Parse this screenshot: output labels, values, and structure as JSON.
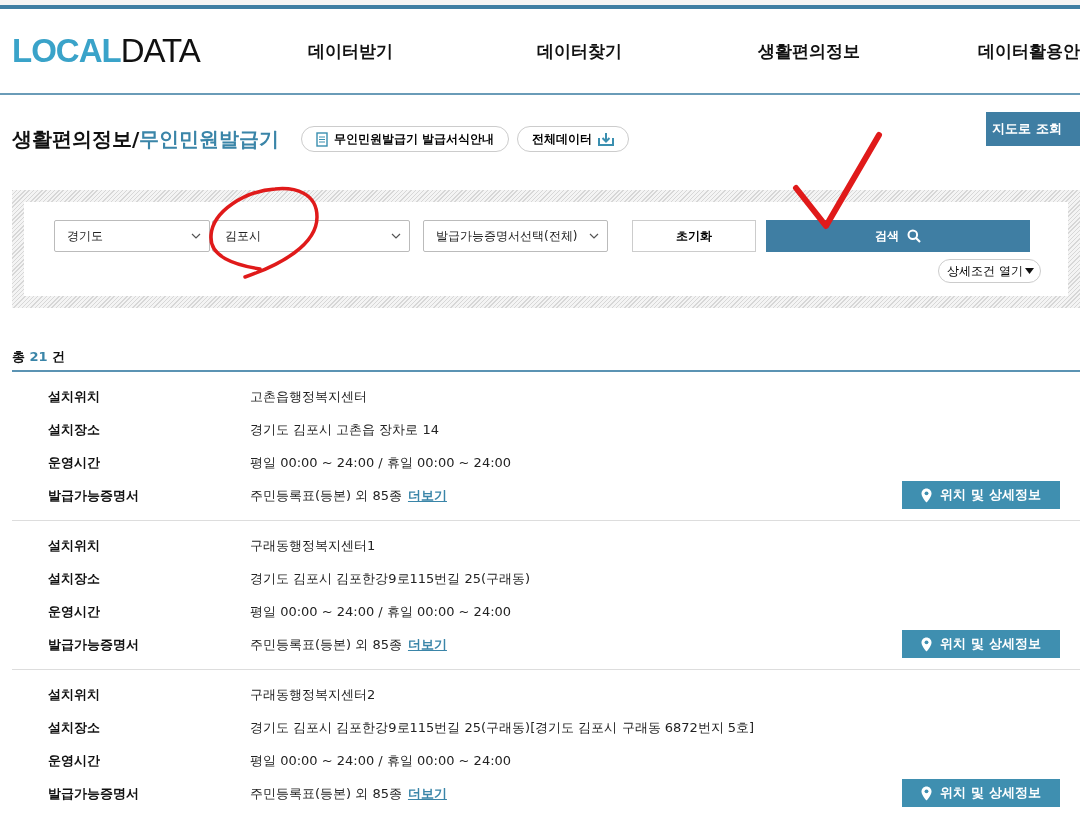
{
  "header": {
    "logo": {
      "part_1": "LOCAL",
      "part_2": "DATA"
    },
    "nav": [
      "데이터받기",
      "데이터찾기",
      "생활편의정보",
      "데이터활용안"
    ]
  },
  "page_title": {
    "category": "생활편의정보/",
    "current": "무인민원발급기"
  },
  "title_buttons": [
    {
      "kind": "document",
      "label": "무인민원발급기 발급서식안내"
    },
    {
      "kind": "download",
      "label": "전체데이터"
    }
  ],
  "map_button": "지도로 조회",
  "filters": {
    "selects": [
      "경기도",
      "김포시",
      "발급가능증명서선택(전체)"
    ],
    "reset": "초기화",
    "search": "검색",
    "details_toggle": "상세조건 열기"
  },
  "summary": {
    "prefix": "총",
    "count": "21",
    "suffix": "건"
  },
  "records": [
    {
      "fields": [
        {
          "label": "설치위치",
          "value": "고촌읍행정복지센터"
        },
        {
          "label": "설치장소",
          "value": "경기도 김포시 고촌읍 장차로 14"
        },
        {
          "label": "운영시간",
          "value": "평일 00:00 ~ 24:00 / 휴일 00:00 ~ 24:00"
        },
        {
          "label": "발급가능증명서",
          "value": "주민등록표(등본) 외 85종",
          "link": "더보기"
        }
      ],
      "detail_button": "위치 및 상세정보"
    },
    {
      "fields": [
        {
          "label": "설치위치",
          "value": "구래동행정복지센터1"
        },
        {
          "label": "설치장소",
          "value": "경기도 김포시 김포한강9로115번길 25(구래동)"
        },
        {
          "label": "운영시간",
          "value": "평일 00:00 ~ 24:00 / 휴일 00:00 ~ 24:00"
        },
        {
          "label": "발급가능증명서",
          "value": "주민등록표(등본) 외 85종",
          "link": "더보기"
        }
      ],
      "detail_button": "위치 및 상세정보"
    },
    {
      "fields": [
        {
          "label": "설치위치",
          "value": "구래동행정복지센터2"
        },
        {
          "label": "설치장소",
          "value": "경기도 김포시 김포한강9로115번길 25(구래동)[경기도 김포시 구래동 6872번지 5호]"
        },
        {
          "label": "운영시간",
          "value": "평일 00:00 ~ 24:00 / 휴일 00:00 ~ 24:00"
        },
        {
          "label": "발급가능증명서",
          "value": "주민등록표(등본) 외 85종",
          "link": "더보기"
        }
      ],
      "detail_button": "위치 및 상세정보"
    }
  ]
}
